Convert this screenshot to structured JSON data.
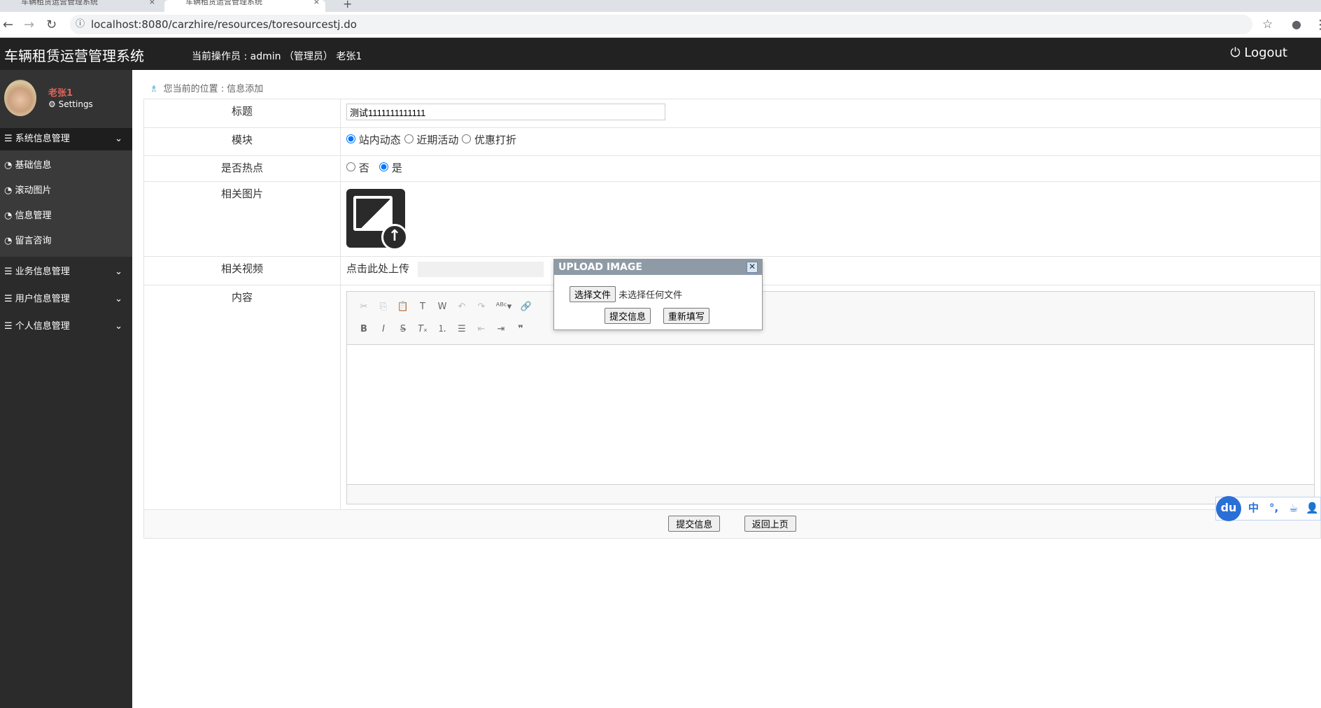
{
  "browser": {
    "tabs": [
      {
        "title": "车辆租赁运营管理系统"
      },
      {
        "title": "车辆租赁运营管理系统"
      }
    ],
    "new_tab": "+",
    "url": "localhost:8080/carzhire/resources/toresourcestj.do"
  },
  "header": {
    "brand": "车辆租赁运营管理系统",
    "operator": "当前操作员 : admin （管理员） 老张1",
    "logout": "Logout"
  },
  "sidebar": {
    "user_name": "老张1",
    "settings": "Settings",
    "menus": [
      {
        "label": "系统信息管理",
        "items": [
          "基础信息",
          "滚动图片",
          "信息管理",
          "留言咨询"
        ]
      },
      {
        "label": "业务信息管理"
      },
      {
        "label": "用户信息管理"
      },
      {
        "label": "个人信息管理"
      }
    ]
  },
  "breadcrumb": "您当前的位置 : 信息添加",
  "form": {
    "title_label": "标题",
    "title_value": "测试1111111111111",
    "module_label": "模块",
    "module_options": [
      "站内动态",
      "近期活动",
      "优惠打折"
    ],
    "module_selected": "站内动态",
    "hot_label": "是否热点",
    "hot_options": [
      "否",
      "是"
    ],
    "hot_selected": "是",
    "image_label": "相关图片",
    "video_label": "相关视频",
    "video_upload": "点击此处上传",
    "content_label": "内容",
    "submit": "提交信息",
    "back": "返回上页"
  },
  "dialog": {
    "title": "UPLOAD IMAGE",
    "choose_file": "选择文件",
    "no_file": "未选择任何文件",
    "submit": "提交信息",
    "reset": "重新填写"
  },
  "ime": {
    "logo": "du",
    "mode": "中"
  }
}
